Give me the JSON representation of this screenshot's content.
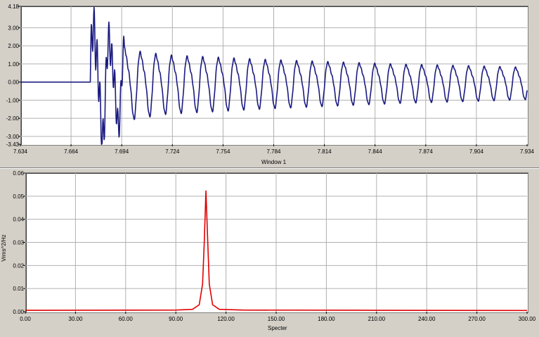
{
  "chart_data": [
    {
      "type": "line",
      "title": "",
      "xlabel": "Window 1",
      "ylabel": "",
      "xlim": [
        7.634,
        7.934
      ],
      "ylim": [
        -3.43,
        4.18
      ],
      "x_ticks": [
        "7.634",
        "7.664",
        "7.694",
        "7.724",
        "7.754",
        "7.784",
        "7.814",
        "7.844",
        "7.874",
        "7.904",
        "7.934"
      ],
      "y_ticks": [
        "4.18",
        "3.00",
        "2.00",
        "1.00",
        "0.00",
        "-1.00",
        "-2.00",
        "-3.00",
        "-3.43"
      ],
      "y_tick_values": [
        4.18,
        3,
        2,
        1,
        0,
        -1,
        -2,
        -3,
        -3.43
      ],
      "grid": true,
      "color": "#1a1a80",
      "series": [
        {
          "onset_x": 7.6755,
          "baseline_y": 0.0,
          "dominant_frequency_hz": 108,
          "envelope": {
            "x": [
              7.676,
              7.68,
              7.69,
              7.7,
              7.72,
              7.75,
              7.78,
              7.82,
              7.86,
              7.9,
              7.934
            ],
            "amplitude": [
              3.9,
              3.4,
              2.5,
              2.05,
              1.75,
              1.6,
              1.45,
              1.3,
              1.15,
              1.05,
              0.95
            ]
          }
        }
      ]
    },
    {
      "type": "line",
      "title": "",
      "xlabel": "Specter",
      "ylabel": "Vrms^2/Hz",
      "xlim": [
        0,
        300
      ],
      "ylim": [
        0,
        0.06
      ],
      "x_ticks": [
        "0.00",
        "30.00",
        "60.00",
        "90.00",
        "120.00",
        "150.00",
        "180.00",
        "210.00",
        "240.00",
        "270.00",
        "300.00"
      ],
      "y_ticks": [
        "0.06",
        "0.05",
        "0.04",
        "0.03",
        "0.02",
        "0.01",
        "0.00"
      ],
      "y_tick_values": [
        0.06,
        0.05,
        0.04,
        0.03,
        0.02,
        0.01,
        0.0
      ],
      "grid": true,
      "color": "#e00000",
      "series": [
        {
          "x": [
            0,
            90,
            100,
            104,
            106,
            107,
            108,
            109,
            110,
            112,
            116,
            130,
            210,
            300
          ],
          "y": [
            0.0006,
            0.0007,
            0.001,
            0.003,
            0.012,
            0.03,
            0.0523,
            0.032,
            0.012,
            0.003,
            0.001,
            0.0007,
            0.0006,
            0.0005
          ]
        }
      ]
    }
  ]
}
